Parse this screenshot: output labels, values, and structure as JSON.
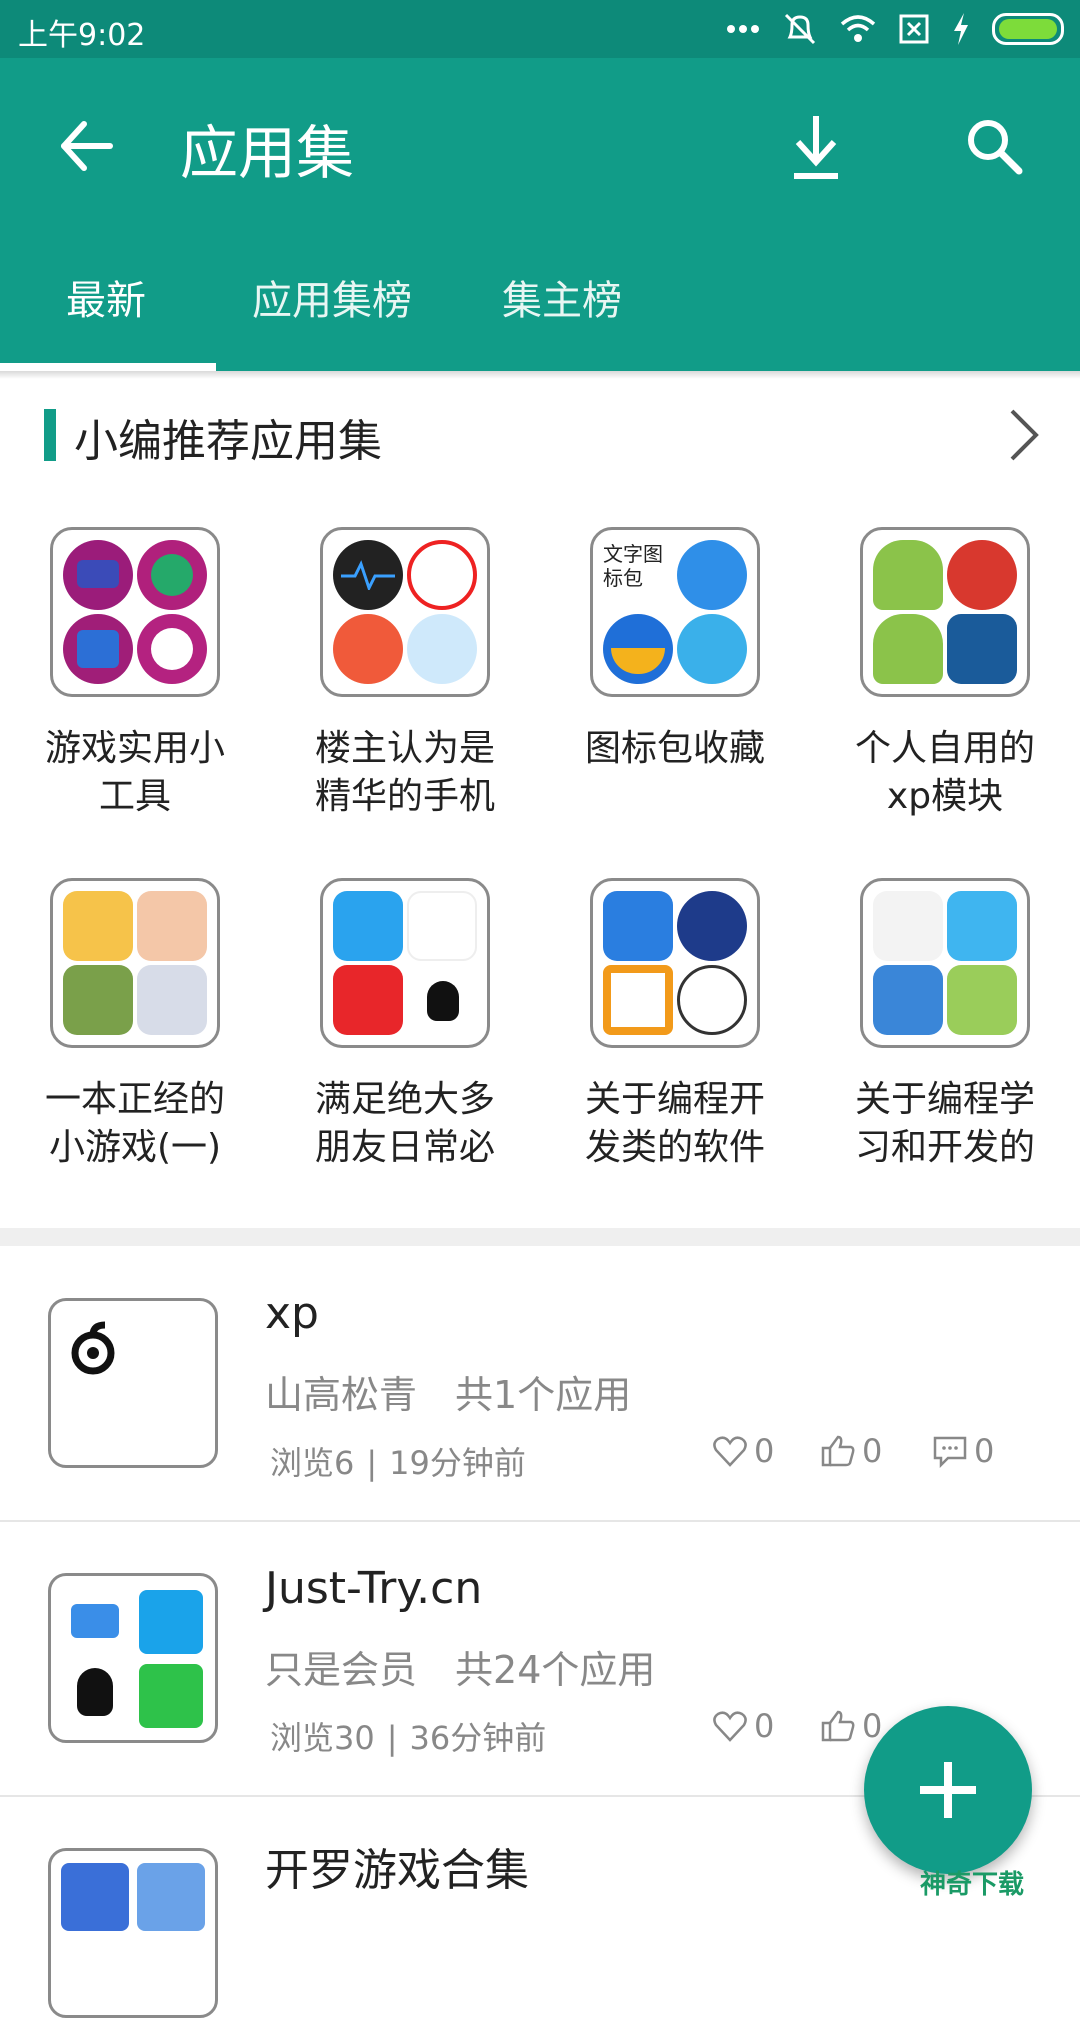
{
  "status_bar": {
    "time": "上午9:02",
    "icons": [
      "more-dots-icon",
      "mute-icon",
      "wifi-icon",
      "sim-off-icon",
      "charging-icon",
      "battery-icon"
    ]
  },
  "app_bar": {
    "title": "应用集",
    "icons": [
      "back-arrow-icon",
      "download-icon",
      "search-icon"
    ],
    "color": "#119c88"
  },
  "tabs": [
    {
      "label": "最新",
      "selected": true
    },
    {
      "label": "应用集榜",
      "selected": false
    },
    {
      "label": "集主榜",
      "selected": false
    }
  ],
  "recommend": {
    "title": "小编推荐应用集",
    "items": [
      {
        "label": "游戏实用小工具"
      },
      {
        "label": "楼主认为是精华的手机"
      },
      {
        "label": "图标包收藏",
        "icon_text": "文字图标包"
      },
      {
        "label": "个人自用的xp模块"
      },
      {
        "label": "一本正经的小游戏(一)"
      },
      {
        "label": "满足绝大多朋友日常必"
      },
      {
        "label": "关于编程开发类的软件"
      },
      {
        "label": "关于编程学习和开发的"
      }
    ]
  },
  "collections": [
    {
      "name": "xp",
      "author": "山高松青",
      "count": "共1个应用",
      "views": "浏览6",
      "time": "19分钟前",
      "favorites": "0",
      "likes": "0",
      "comments": "0"
    },
    {
      "name": "Just-Try.cn",
      "author": "只是会员",
      "count": "共24个应用",
      "views": "浏览30",
      "time": "36分钟前",
      "favorites": "0",
      "likes": "0"
    },
    {
      "name": "开罗游戏合集"
    }
  ],
  "fab": {
    "icon": "plus-icon"
  },
  "watermark": "神奇下载"
}
